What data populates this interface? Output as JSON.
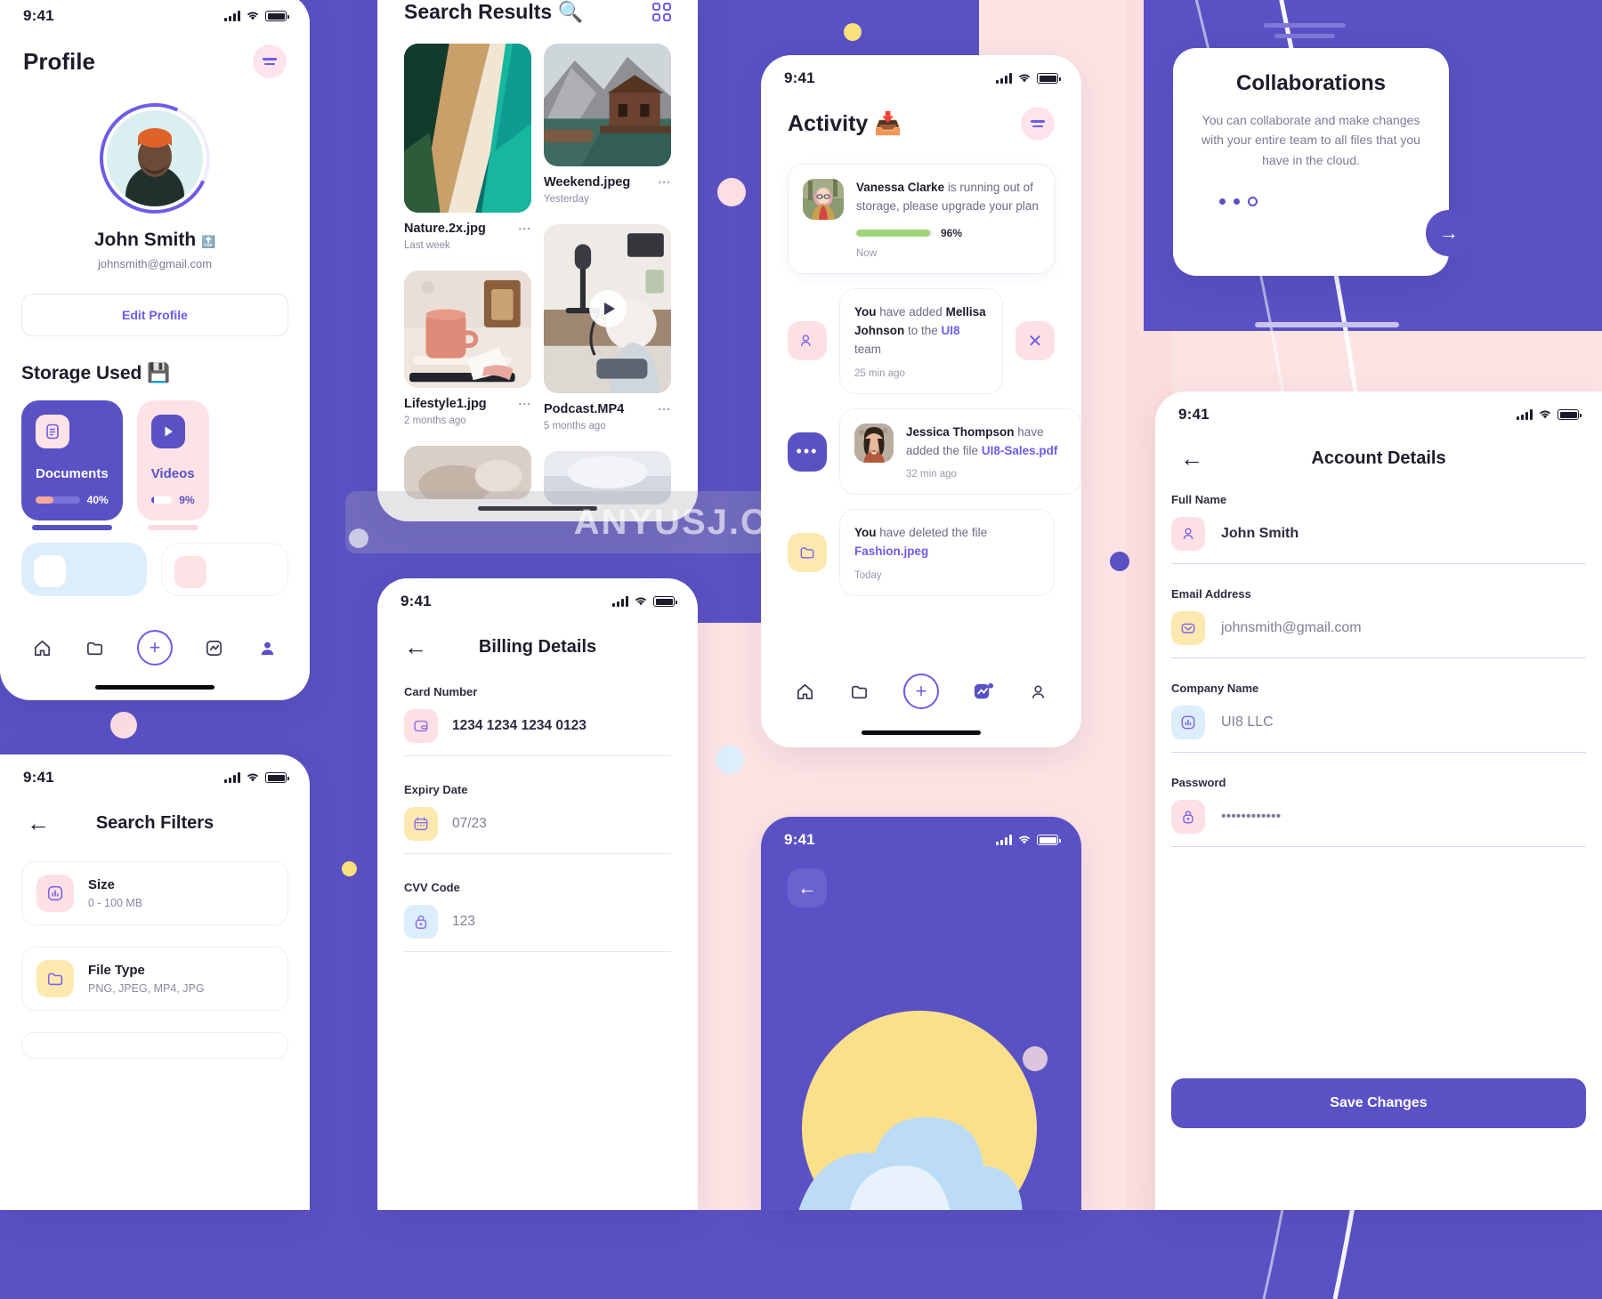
{
  "status_bar": {
    "time": "9:41"
  },
  "profile": {
    "title": "Profile",
    "menu_icon": "hamburger-icon",
    "avatar_icon": "user-photo",
    "name": "John Smith",
    "name_badge": "🔝",
    "email": "johnsmith@gmail.com",
    "edit_button": "Edit Profile",
    "storage_title": "Storage Used 💾",
    "storage_cards": [
      {
        "label": "Documents",
        "percent": "40%",
        "fill": 40,
        "icon": "document-icon",
        "theme": "dark"
      },
      {
        "label": "Videos",
        "percent": "9%",
        "fill": 9,
        "icon": "play-icon",
        "theme": "light"
      }
    ],
    "tabs": [
      "home-icon",
      "folder-icon",
      "plus-icon",
      "activity-icon",
      "profile-icon"
    ]
  },
  "search_results": {
    "title": "Search Results 🔍",
    "grid_icon": "grid-view-icon",
    "files": [
      {
        "name": "Nature.2x.jpg",
        "time": "Last week",
        "dots": "...",
        "kind": "beach"
      },
      {
        "name": "Weekend.jpeg",
        "time": "Yesterday",
        "dots": "...",
        "kind": "cabin"
      },
      {
        "name": "Lifestyle1.jpg",
        "time": "2 months ago",
        "dots": "...",
        "kind": "desk"
      },
      {
        "name": "Podcast.MP4",
        "time": "5 months ago",
        "dots": "...",
        "kind": "podcast"
      }
    ]
  },
  "activity": {
    "title": "Activity 📥",
    "menu_icon": "hamburger-icon",
    "items": [
      {
        "avatar": "vanessa-photo",
        "text_pre": "",
        "name": "Vanessa Clarke",
        "text": " is running out of storage, please upgrade your plan",
        "progress": "96%",
        "progress_value": 96,
        "time": "Now"
      },
      {
        "left_icon": "add-user-icon",
        "text_you": "You",
        "text_mid": " have added ",
        "bold_name": "Mellisa Johnson",
        "text_tail": " to the ",
        "link": "UI8",
        "text_end": " team",
        "time": "25 min ago",
        "close_icon": "close-icon"
      },
      {
        "left_icon": "more-icon",
        "avatar": "jessica-photo",
        "name": "Jessica Thompson",
        "text": " have added the file ",
        "link": "UI8-Sales.pdf",
        "time": "32 min ago"
      },
      {
        "left_icon": "folder-icon",
        "text_you": "You",
        "text": " have deleted the file ",
        "link": "Fashion.jpeg",
        "time": "Today"
      }
    ],
    "tabs": [
      "home-icon",
      "folder-icon",
      "plus-icon",
      "activity-icon",
      "profile-icon"
    ]
  },
  "collaborations": {
    "title": "Collaborations",
    "body": "You can collaborate and make changes with your entire team to all files that you have in the cloud.",
    "next_icon": "arrow-right-icon",
    "dots": 3,
    "active_dot": 3
  },
  "billing": {
    "title": "Billing Details",
    "back_icon": "arrow-left-icon",
    "fields": [
      {
        "label": "Card Number",
        "value": "1234 1234 1234 0123",
        "icon": "wallet-icon",
        "icon_theme": "pink",
        "muted": false
      },
      {
        "label": "Expiry Date",
        "value": "07/23",
        "icon": "calendar-icon",
        "icon_theme": "yellow",
        "muted": true
      },
      {
        "label": "CVV Code",
        "value": "123",
        "icon": "lock-icon",
        "icon_theme": "blue",
        "muted": true
      }
    ]
  },
  "search_filters": {
    "title": "Search Filters",
    "back_icon": "arrow-left-icon",
    "rows": [
      {
        "name": "Size",
        "sub": "0 - 100 MB",
        "icon": "chart-icon",
        "icon_theme": "pink"
      },
      {
        "name": "File Type",
        "sub": "PNG, JPEG, MP4, JPG",
        "icon": "folder-icon",
        "icon_theme": "yellow"
      }
    ]
  },
  "account_details": {
    "title": "Account Details",
    "back_icon": "arrow-left-icon",
    "fields": [
      {
        "label": "Full Name",
        "value": "John Smith",
        "icon": "user-icon",
        "icon_theme": "pink",
        "muted": false
      },
      {
        "label": "Email Address",
        "value": "johnsmith@gmail.com",
        "icon": "mail-icon",
        "icon_theme": "yellow",
        "muted": true
      },
      {
        "label": "Company Name",
        "value": "UI8 LLC",
        "icon": "chart-icon",
        "icon_theme": "blue",
        "muted": true
      },
      {
        "label": "Password",
        "value": "••••••••••••",
        "icon": "lock-icon",
        "icon_theme": "pink",
        "muted": true
      }
    ],
    "save_button": "Save Changes"
  },
  "cloud_screen": {
    "back_icon": "arrow-left-icon"
  },
  "watermark": {
    "text": "ANYUSJ.COM"
  },
  "colors": {
    "brand_purple": "#5a51c4",
    "accent_purple": "#6c5ce7",
    "pink_bg": "#fde4e4",
    "pink_icon": "#fde0e4",
    "yellow_icon": "#fde9b0",
    "blue_icon": "#dcedfc",
    "green_progress": "#9fd477",
    "peach_progress": "#f7a99a",
    "text_dark": "#1c1c2b",
    "text_muted": "#8a8aa3"
  }
}
